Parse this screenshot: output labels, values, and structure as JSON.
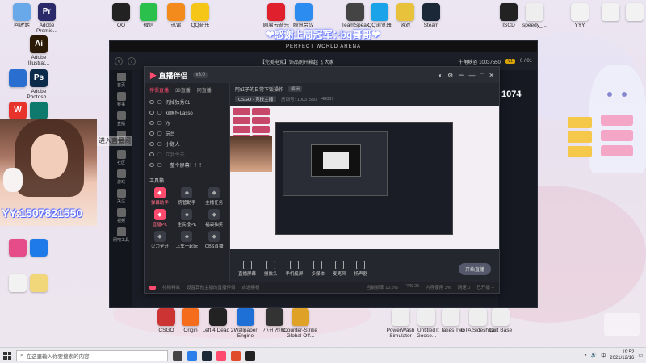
{
  "banner": "❤感谢上周冠军：·bq哥哥❤",
  "desktop_icons_top": [
    {
      "label": "回收站",
      "color": "#6aa9e9"
    },
    {
      "label": "Adobe Premie...",
      "color": "#2a2a6a",
      "glyph": "Pr"
    },
    {
      "label": "QQ",
      "color": "#222"
    },
    {
      "label": "微信",
      "color": "#2ac04b"
    },
    {
      "label": "迅雷",
      "color": "#f28a1c"
    },
    {
      "label": "QQ音乐",
      "color": "#f5c518"
    },
    {
      "label": "网易云音乐",
      "color": "#e0202c"
    },
    {
      "label": "腾讯会议",
      "color": "#2d8cf0"
    },
    {
      "label": "TeamSpeak",
      "color": "#444"
    },
    {
      "label": "QQ浏览器",
      "color": "#1aa3e8"
    },
    {
      "label": "游戏",
      "color": "#e8c23b"
    },
    {
      "label": "Steam",
      "color": "#1b2838"
    },
    {
      "label": "ISCD",
      "color": "#222"
    },
    {
      "label": "speedy_...",
      "color": "#eee"
    },
    {
      "label": "YYY",
      "color": "#f2f2f2"
    },
    {
      "label": "",
      "color": "#f2f2f2"
    },
    {
      "label": "",
      "color": "#f2f2f2"
    }
  ],
  "desktop_icons_left": [
    {
      "label": "Adobe Illustrat...",
      "color": "#2b1a06",
      "glyph": "Ai"
    },
    {
      "label": "",
      "color": "#2a6ecf"
    },
    {
      "label": "Adobe Photosh...",
      "color": "#0c2a4a",
      "glyph": "Ps"
    },
    {
      "label": "WPS",
      "color": "#e8322c",
      "glyph": "W"
    },
    {
      "label": "",
      "color": "#0d7a6d"
    }
  ],
  "desktop_icons_left2": [
    {
      "label": "",
      "color": "#e64b8a"
    },
    {
      "label": "",
      "color": "#1e7ae8"
    },
    {
      "label": "",
      "color": "#f2f2f2"
    },
    {
      "label": "",
      "color": "#f2d67a"
    }
  ],
  "desktop_icons_bottom": [
    {
      "label": "CSGO",
      "color": "#c33"
    },
    {
      "label": "Origin",
      "color": "#f56c1c"
    },
    {
      "label": "Left 4 Dead 2",
      "color": "#222"
    },
    {
      "label": "Wallpaper Engine",
      "color": "#1e6fd6"
    },
    {
      "label": "小丑 战舰",
      "color": "#333"
    },
    {
      "label": "Counter-Strike Global Off...",
      "color": "#e0a127"
    },
    {
      "label": "PowerWash Simulator",
      "color": "#eee"
    },
    {
      "label": "Untitled Goose...",
      "color": "#eee"
    },
    {
      "label": "It Takes Two",
      "color": "#eee"
    },
    {
      "label": "GTA Sideshow",
      "color": "#eee"
    },
    {
      "label": "Cult Base",
      "color": "#eee"
    }
  ],
  "main_window": {
    "header": "PERFECT WORLD ARENA",
    "tab_title": "【完美电竞】饰品刷开箱起飞 大家",
    "right_title": "牛角峡谷 10037550",
    "level": "V1",
    "right_count": "0 / 01",
    "rail": [
      "首页",
      "赛事",
      "直播",
      "商城",
      "社区",
      "游戏",
      "关注",
      "视频",
      "网吧工具"
    ],
    "score": "1074"
  },
  "assistant": {
    "logo": "直播伴侣",
    "version": "v3.0",
    "tabs": [
      "伴侣直播",
      "38直播",
      "同直播"
    ],
    "scenes": [
      {
        "label": "扔掉独秀01",
        "dim": false
      },
      {
        "label": "双屏挂Lasso",
        "dim": false
      },
      {
        "label": "yy",
        "dim": false
      },
      {
        "label": "玩台",
        "dim": false
      },
      {
        "label": "小题人",
        "dim": false
      },
      {
        "label": "立我今天",
        "dim": true
      },
      {
        "label": "一整个屏幕！！！",
        "dim": false
      }
    ],
    "tools_title": "工具箱",
    "tools": [
      {
        "label": "弹幕助手",
        "red": true
      },
      {
        "label": "房管助手",
        "red": false
      },
      {
        "label": "主播任务",
        "red": false
      },
      {
        "label": "直播PK",
        "red": true
      },
      {
        "label": "全民投PK",
        "red": false
      },
      {
        "label": "福袋抽奖",
        "red": false
      },
      {
        "label": "火力全开",
        "red": false
      },
      {
        "label": "上车一起玩",
        "red": false
      },
      {
        "label": "OBS直播",
        "red": false
      }
    ],
    "stream_title": "阿虹子的日常下饭操作",
    "edit_chip": "编辑",
    "game": "CSGO - 竞技主播",
    "room_id": "房间号: 10037550",
    "fans": "48837",
    "bottom_buttons": [
      "直播屏幕",
      "摄像头",
      "手机投屏",
      "多媒体",
      "麦克风",
      "扬声器"
    ],
    "start_button": "开始直播",
    "status": [
      "礼物特效",
      "设置其他主播的直播伴侣",
      "自选模板"
    ],
    "status_right": [
      "当前帧率 10.5%",
      "FPS 25",
      "内存使用 3%",
      "网速 0",
      "已开播 --"
    ]
  },
  "overlay": {
    "enter_room": "进入直播间",
    "yy_id": "YY:1507821550"
  },
  "taskbar": {
    "search_placeholder": "在这里输入你要搜索的内容",
    "time": "19:52",
    "date": "2021/12/16",
    "tray_text": "中"
  }
}
